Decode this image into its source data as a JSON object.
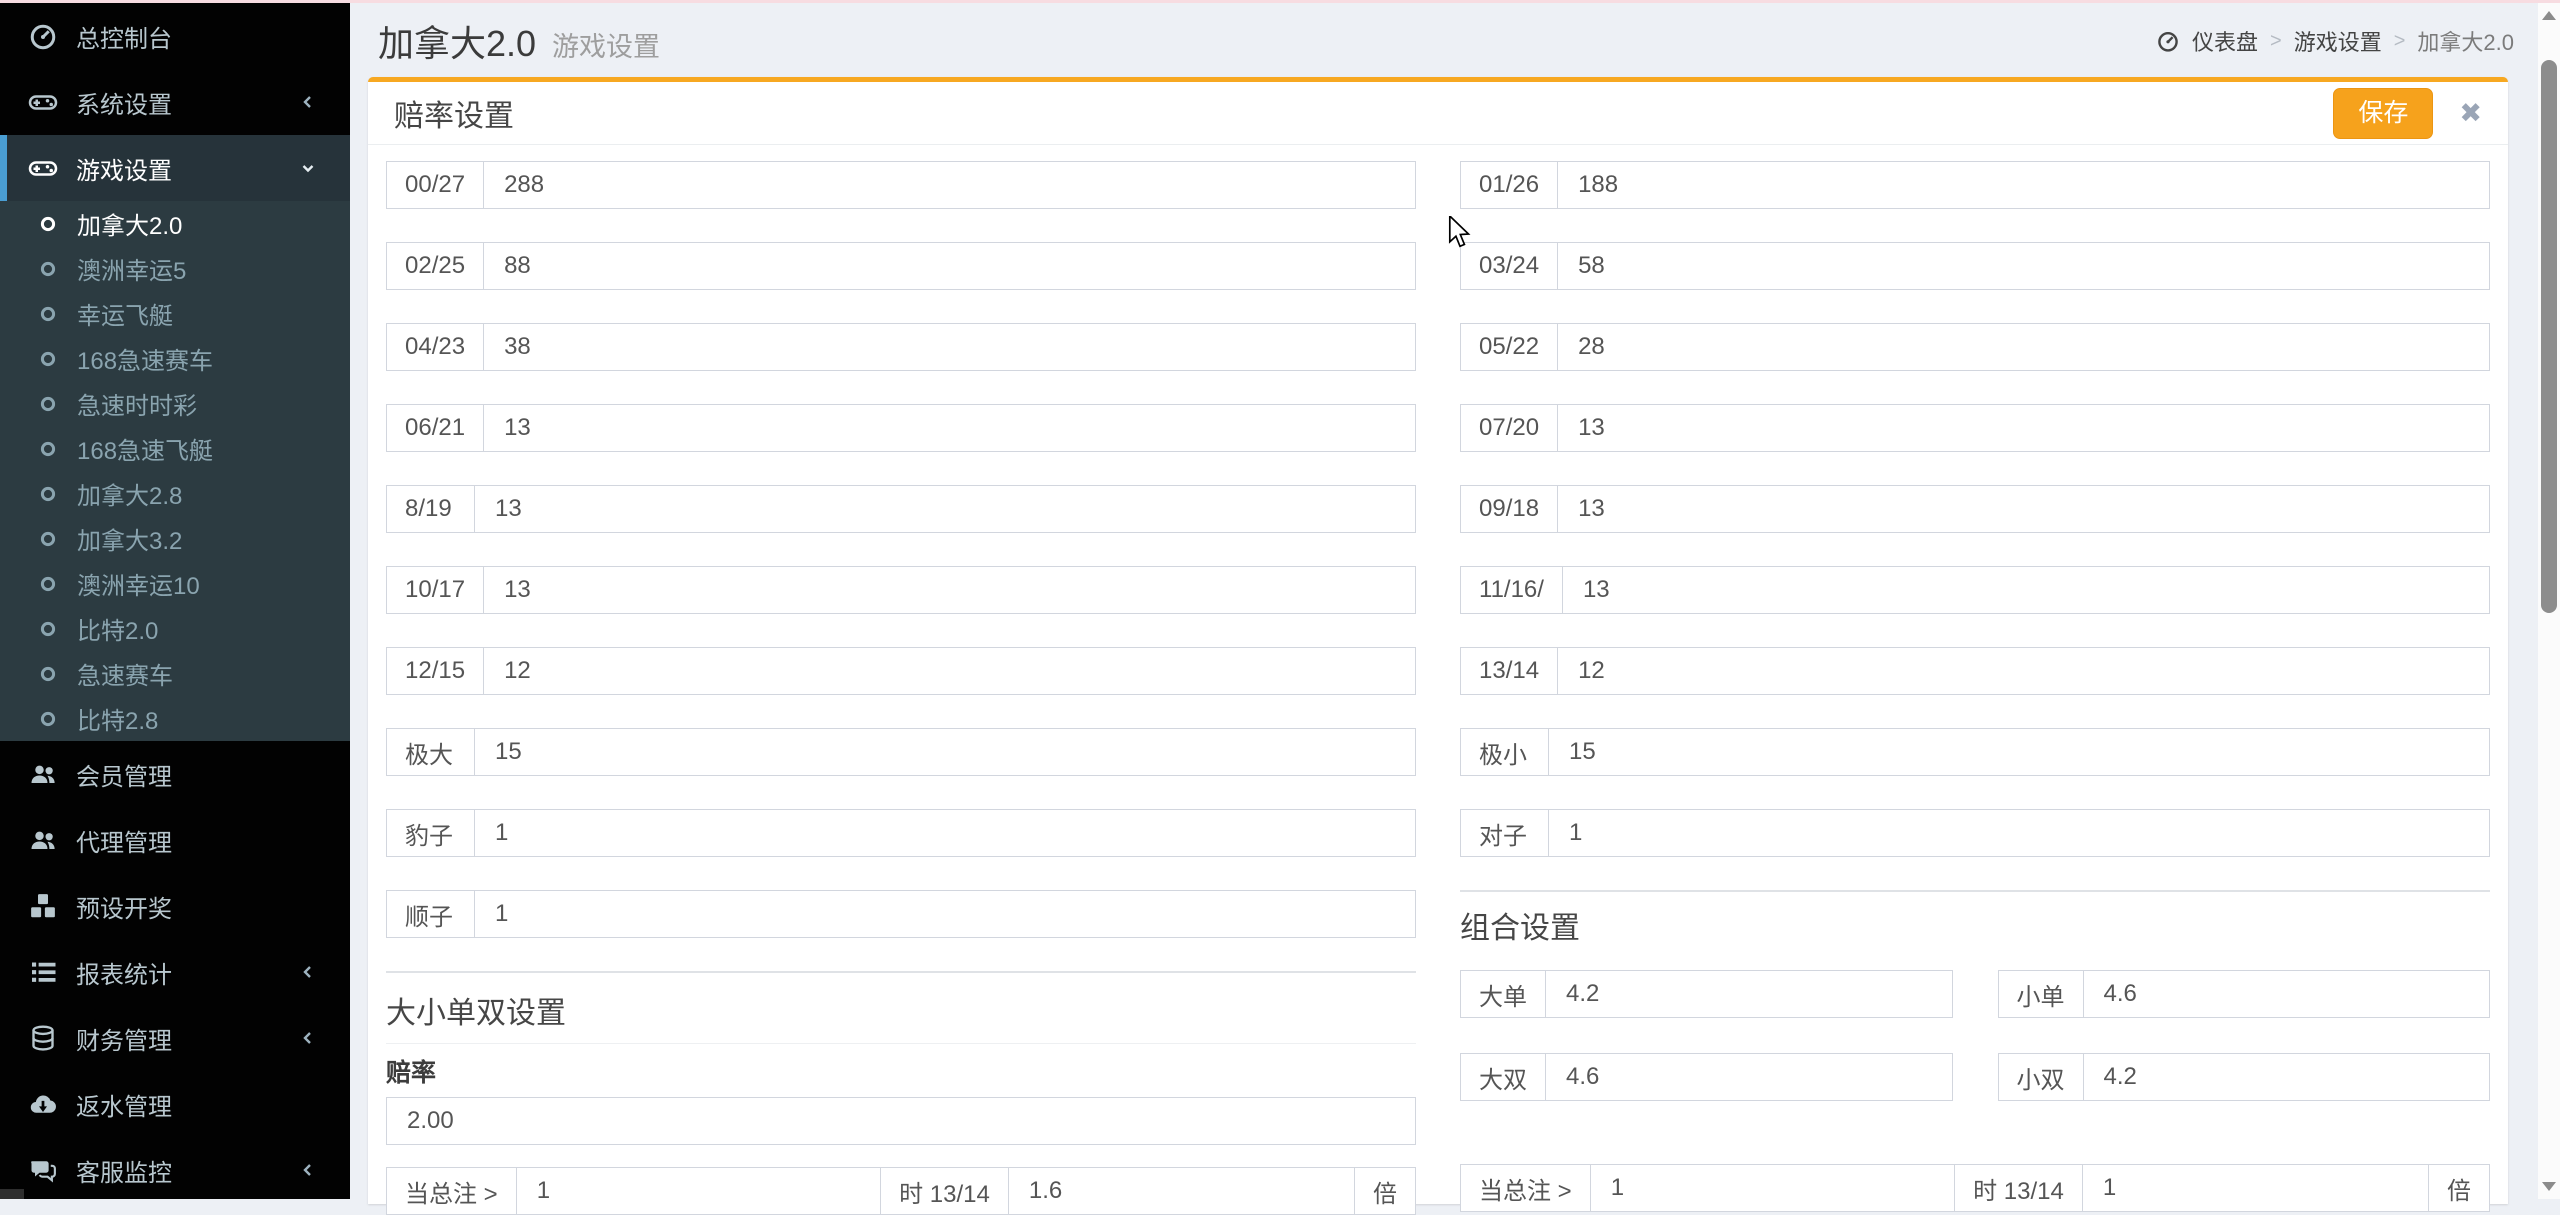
{
  "colors": {
    "accent_orange": "#f6a21c",
    "panel_top_border": "#f7a821",
    "sidebar_active_border": "#4a9ed3",
    "sidebar_bg": "#020202",
    "submenu_bg": "#2c3b41",
    "content_bg": "#edf0f5"
  },
  "sidebar": {
    "items": [
      {
        "label": "总控制台",
        "icon": "dashboard-icon"
      },
      {
        "label": "系统设置",
        "icon": "gamepad-icon"
      },
      {
        "label": "游戏设置",
        "icon": "gamepad-icon",
        "children": [
          "加拿大2.0",
          "澳洲幸运5",
          "幸运飞艇",
          "168急速赛车",
          "急速时时彩",
          "168急速飞艇",
          "加拿大2.8",
          "加拿大3.2",
          "澳洲幸运10",
          "比特2.0",
          "急速赛车",
          "比特2.8"
        ],
        "active_child": "加拿大2.0"
      },
      {
        "label": "会员管理",
        "icon": "users-icon"
      },
      {
        "label": "代理管理",
        "icon": "users-icon"
      },
      {
        "label": "预设开奖",
        "icon": "cubes-icon"
      },
      {
        "label": "报表统计",
        "icon": "list-ol-icon"
      },
      {
        "label": "财务管理",
        "icon": "database-icon"
      },
      {
        "label": "返水管理",
        "icon": "cloud-download-icon"
      },
      {
        "label": "客服监控",
        "icon": "comments-icon"
      }
    ]
  },
  "header": {
    "title": "加拿大2.0",
    "subtitle": "游戏设置",
    "breadcrumb": [
      "仪表盘",
      "游戏设置",
      "加拿大2.0"
    ]
  },
  "panel": {
    "title": "赔率设置",
    "save_label": "保存",
    "close_label": "✖",
    "odds_left": [
      {
        "label": "00/27",
        "value": "288"
      },
      {
        "label": "02/25",
        "value": "88"
      },
      {
        "label": "04/23",
        "value": "38"
      },
      {
        "label": "06/21",
        "value": "13"
      },
      {
        "label": "8/19",
        "value": "13"
      },
      {
        "label": "10/17",
        "value": "13"
      },
      {
        "label": "12/15",
        "value": "12"
      },
      {
        "label": "极大",
        "value": "15"
      },
      {
        "label": "豹子",
        "value": "1"
      },
      {
        "label": "顺子",
        "value": "1"
      }
    ],
    "odds_right": [
      {
        "label": "01/26",
        "value": "188"
      },
      {
        "label": "03/24",
        "value": "58"
      },
      {
        "label": "05/22",
        "value": "28"
      },
      {
        "label": "07/20",
        "value": "13"
      },
      {
        "label": "09/18",
        "value": "13"
      },
      {
        "label": "11/16/",
        "value": "13"
      },
      {
        "label": "13/14",
        "value": "12"
      },
      {
        "label": "极小",
        "value": "15"
      },
      {
        "label": "对子",
        "value": "1"
      }
    ],
    "dsdd": {
      "title": "大小单双设置",
      "odds_label": "赔率",
      "odds_value": "2.00",
      "rule": {
        "prefix": "当总注 >",
        "threshold": "1",
        "mid": "时 13/14",
        "rate": "1.6",
        "suffix": "倍"
      }
    },
    "combo": {
      "title": "组合设置",
      "fields": [
        {
          "label": "大单",
          "value": "4.2"
        },
        {
          "label": "小单",
          "value": "4.6"
        },
        {
          "label": "大双",
          "value": "4.6"
        },
        {
          "label": "小双",
          "value": "4.2"
        }
      ],
      "rule": {
        "prefix": "当总注 >",
        "threshold": "1",
        "mid": "时 13/14",
        "rate": "1",
        "suffix": "倍"
      }
    }
  }
}
